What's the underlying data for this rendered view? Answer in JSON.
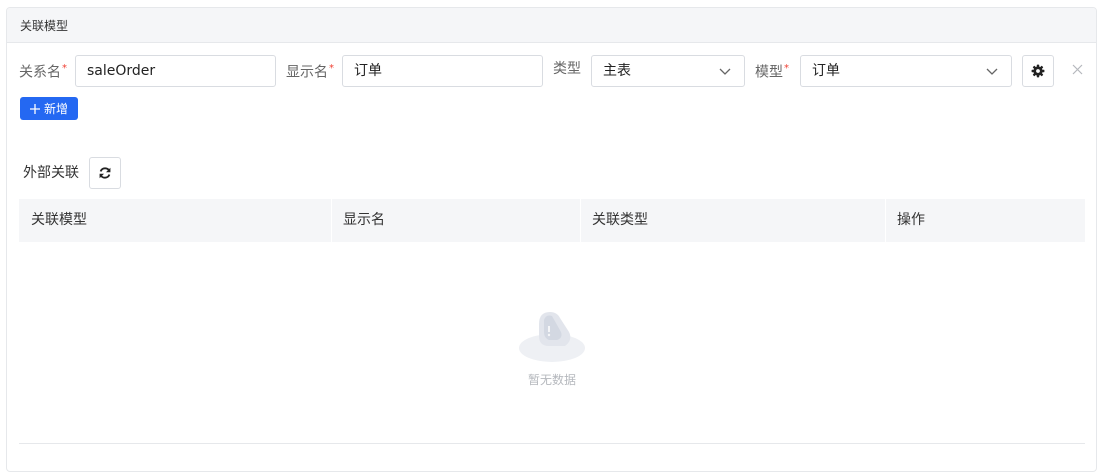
{
  "panel": {
    "title": "关联模型"
  },
  "form": {
    "relation_name_label": "关系名",
    "relation_name_value": "saleOrder",
    "display_name_label": "显示名",
    "display_name_value": "订单",
    "type_label": "类型",
    "type_value": "主表",
    "model_label": "模型",
    "model_value": "订单",
    "required_mark": "*",
    "close_icon": "close-icon",
    "settings_icon": "gear-icon"
  },
  "add_button": {
    "label": "新增",
    "icon": "plus-icon",
    "color": "#2468f2"
  },
  "external": {
    "title": "外部关联",
    "refresh_icon": "refresh-icon",
    "columns": [
      "关联模型",
      "显示名",
      "关联类型",
      "操作"
    ],
    "rows": [],
    "empty_text": "暂无数据"
  }
}
